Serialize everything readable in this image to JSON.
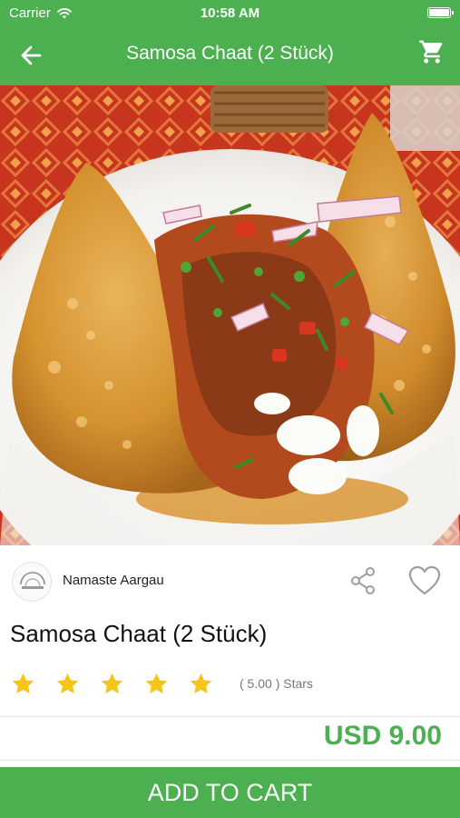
{
  "status_bar": {
    "carrier": "Carrier",
    "time": "10:58 AM"
  },
  "nav": {
    "title": "Samosa Chaat (2 Stück)",
    "back_icon": "arrow-left-icon",
    "cart_icon": "shopping-cart-icon"
  },
  "hero": {
    "image": "samosa-chaat-photo"
  },
  "product": {
    "restaurant": "Namaste Aargau",
    "name": "Samosa Chaat (2 Stück)",
    "rating": 5,
    "rating_text": "( 5.00 ) Stars",
    "price": "USD 9.00"
  },
  "actions": {
    "add_to_cart": "ADD TO CART"
  },
  "colors": {
    "primary": "#4caf50",
    "star": "#f5c518"
  }
}
